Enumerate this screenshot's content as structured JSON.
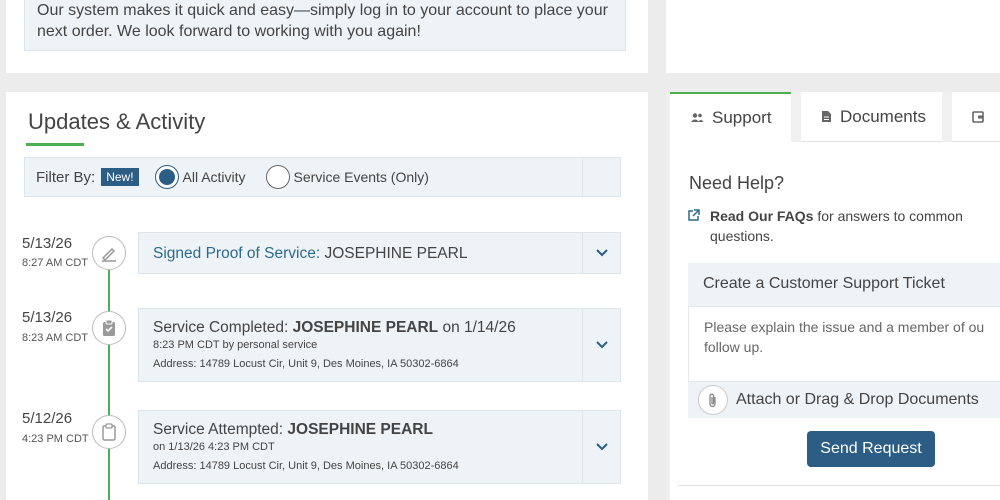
{
  "notice": {
    "line1": "Our system makes it quick and easy—simply log in to your account to place your",
    "line2": "next order. We look forward to working with you again!"
  },
  "activity": {
    "title": "Updates & Activity",
    "filter": {
      "label": "Filter By:",
      "badge": "New!",
      "options": [
        {
          "label": "All Activity",
          "checked": true
        },
        {
          "label": "Service Events (Only)",
          "checked": false
        }
      ]
    },
    "events": [
      {
        "date": "5/13/26",
        "time": "8:27 AM CDT",
        "icon": "signature-icon",
        "title_prefix": "Signed Proof of Service:",
        "title_name": "JOSEPHINE PEARL"
      },
      {
        "date": "5/13/26",
        "time": "8:23 AM CDT",
        "icon": "clipboard-check-icon",
        "title_prefix": "Service Completed:",
        "title_name": "JOSEPHINE PEARL",
        "title_suffix": "on 1/14/26",
        "sub": "8:23 PM CDT by personal service",
        "address": "Address:  14789 Locust Cir, Unit 9, Des Moines, IA 50302-6864"
      },
      {
        "date": "5/12/26",
        "time": "4:23 PM CDT",
        "icon": "clipboard-icon",
        "title_prefix": "Service Attempted:",
        "title_name": "JOSEPHINE PEARL",
        "sub": "on 1/13/26 4:23 PM CDT",
        "address": "Address:  14789 Locust Cir, Unit 9, Des Moines, IA 50302-6864"
      }
    ]
  },
  "side": {
    "tabs": [
      {
        "label": "Support",
        "icon": "people-icon",
        "active": true
      },
      {
        "label": "Documents",
        "icon": "document-icon",
        "active": false
      },
      {
        "label": "",
        "icon": "wallet-icon",
        "active": false
      }
    ],
    "help_title": "Need Help?",
    "faq_bold": "Read Our FAQs",
    "faq_rest_1": " for answers to common",
    "faq_rest_2": "questions.",
    "ticket_title": "Create a Customer Support Ticket",
    "ticket_placeholder_1": "Please explain the  issue and a member of ou",
    "ticket_placeholder_2": "follow up.",
    "attach_label": "Attach or Drag & Drop Documents",
    "send_label": "Send Request"
  },
  "colors": {
    "accent_green": "#4caf50",
    "primary_blue": "#2c5d85",
    "link_blue": "#2c6a8f"
  }
}
